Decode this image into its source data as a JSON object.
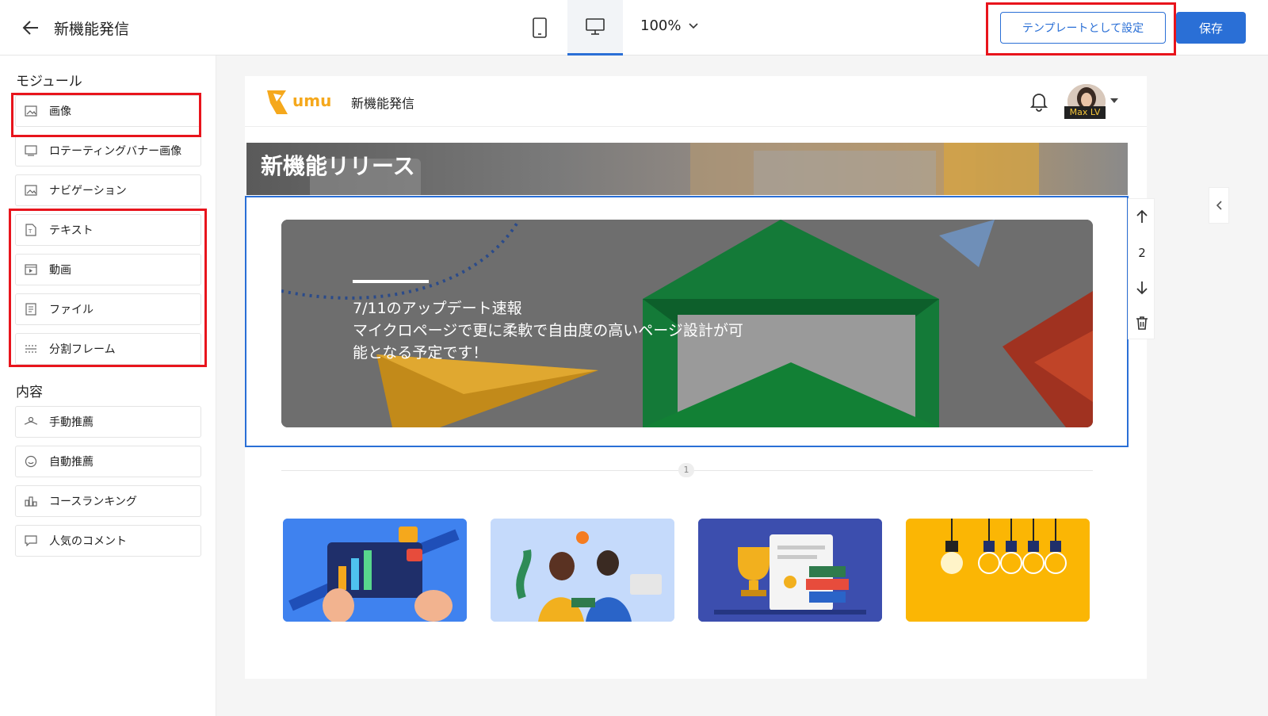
{
  "header": {
    "title": "新機能発信",
    "zoom": "100%",
    "template_label": "テンプレートとして設定",
    "save_label": "保存"
  },
  "sidebar": {
    "modules_title": "モジュール",
    "modules": [
      {
        "label": "画像",
        "icon": "image-icon"
      },
      {
        "label": "ロテーティングバナー画像",
        "icon": "banner-icon"
      },
      {
        "label": "ナビゲーション",
        "icon": "navigation-icon"
      },
      {
        "label": "テキスト",
        "icon": "text-icon"
      },
      {
        "label": "動画",
        "icon": "video-icon"
      },
      {
        "label": "ファイル",
        "icon": "file-icon"
      },
      {
        "label": "分割フレーム",
        "icon": "divider-icon"
      }
    ],
    "content_title": "内容",
    "contents": [
      {
        "label": "手動推薦",
        "icon": "manual-recommend-icon"
      },
      {
        "label": "自動推薦",
        "icon": "auto-recommend-icon"
      },
      {
        "label": "コースランキング",
        "icon": "ranking-icon"
      },
      {
        "label": "人気のコメント",
        "icon": "comment-icon"
      }
    ]
  },
  "page": {
    "logo_text": "umu",
    "title": "新機能発信",
    "user_name": "Max LV",
    "hero_title": "新機能リリース",
    "banner_text_1": "7/11のアップデート速報",
    "banner_text_2": "マイクロページで更に柔軟で自由度の高いページ設計が可",
    "banner_text_3": "能となる予定です！",
    "module_index": "2",
    "divider_number": "1"
  },
  "colors": {
    "primary": "#2a6fd6",
    "highlight": "#e8141c"
  }
}
